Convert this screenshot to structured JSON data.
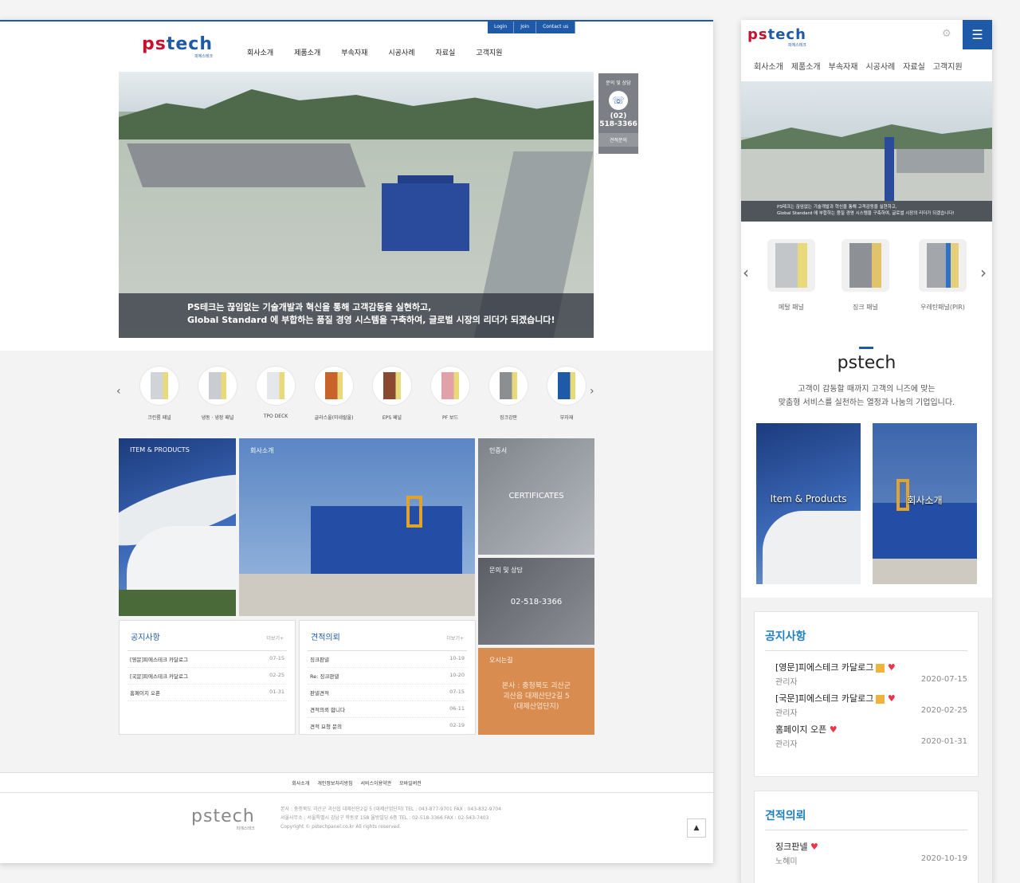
{
  "brand": {
    "part1": "ps",
    "part2": "tech",
    "sub": "피에스테크"
  },
  "desktop": {
    "top_links": [
      "Login",
      "Join",
      "Contact us"
    ],
    "nav": [
      "회사소개",
      "제품소개",
      "부속자재",
      "시공사례",
      "자료실",
      "고객지원"
    ],
    "hero": {
      "line1": "PS테크는 끊임없는 기술개발과 혁신을 통해 고객감동을 실현하고,",
      "line2": "Global Standard 에 부합하는 품질 경영 시스템을 구축하여, 글로벌 시장의 리더가 되겠습니다!"
    },
    "contact_box": {
      "title": "문의 및 상담",
      "tel": "(02)\n518-3366",
      "quote": "견적문의"
    },
    "products": [
      {
        "label": "크린룸 패널",
        "color": "#d0d4d8"
      },
      {
        "label": "냉동 · 냉장 패널",
        "color": "#c9ccd0"
      },
      {
        "label": "TPO DECK",
        "color": "#e4e8ea"
      },
      {
        "label": "글라스울(미네랄울)",
        "color": "#c8642a"
      },
      {
        "label": "EPS 패널",
        "color": "#8a4a32"
      },
      {
        "label": "PF 보드",
        "color": "#e2a0a8"
      },
      {
        "label": "징크강판",
        "color": "#8c8f92"
      },
      {
        "label": "부자재",
        "color": "#1e5aa8"
      }
    ],
    "tiles": {
      "items": "ITEM & PRODUCTS",
      "about": "회사소개",
      "cert_label": "인증서",
      "cert_center": "CERTIFICATES",
      "inq_label": "문의 및 상담",
      "inq_center": "02-518-3366",
      "loc_label": "오시는길",
      "loc_center": "본사 : 충청북도 괴산군\n괴산읍 대제산단2길 5\n(대제산업단지)"
    },
    "notice": {
      "title": "공지사항",
      "more": "더보기+",
      "rows": [
        {
          "t": "[영문]피에스테크 카달로그",
          "d": "07-15"
        },
        {
          "t": "[국문]피에스테크 카달로그",
          "d": "02-25"
        },
        {
          "t": "홈페이지 오픈",
          "d": "01-31"
        }
      ]
    },
    "quote": {
      "title": "견적의뢰",
      "more": "더보기+",
      "rows": [
        {
          "t": "징크판넬",
          "d": "10-19"
        },
        {
          "t": "Re: 징크판넬",
          "d": "10-20"
        },
        {
          "t": "판넬견적",
          "d": "07-15"
        },
        {
          "t": "견적의뢰 합니다",
          "d": "06-11"
        },
        {
          "t": "견적 요청 문의",
          "d": "02-19"
        }
      ]
    },
    "footer_nav": [
      "회사소개",
      "개인정보처리방침",
      "서비스이용약관",
      "모바일버전"
    ],
    "footer_info": [
      "본사 : 충청북도 괴산군 괴산읍 대제산단2길 5 (대제산업단지)   TEL : 043-877-9701 FAX : 043-832-9704",
      "서울사무소 : 서울특별시 강남구 학동로 158 율방빌딩 6층 TEL : 02-518-3366 FAX : 02-543-7403",
      "Copyright © pstechpanel.co.kr All rights reserved."
    ]
  },
  "mobile": {
    "nav": [
      "회사소개",
      "제품소개",
      "부속자재",
      "시공사례",
      "자료실",
      "고객지원"
    ],
    "hero_cap": {
      "line1": "PS테크는 끊임없는 기술개발과 혁신을 통해 고객감동을 실현하고,",
      "line2": "Global Standard 에 부합하는 품질 경영 시스템을 구축하여, 글로벌 시장의 리더가 되겠습니다!"
    },
    "products": [
      "메탈 패널",
      "징크 패널",
      "우레탄패널(PIR)"
    ],
    "intro_title": "pstech",
    "intro_line1": "고객이 감동할 때까지 고객의 니즈에 맞는",
    "intro_line2": "맞춤형 서비스를 실천하는 열정과 나눔의 기업입니다.",
    "card1": "Item & Products",
    "card2": "회사소개",
    "notice": {
      "title": "공지사항",
      "items": [
        {
          "t": "[영문]피에스테크 카달로그",
          "a": "관리자",
          "d": "2020-07-15"
        },
        {
          "t": "[국문]피에스테크 카달로그",
          "a": "관리자",
          "d": "2020-02-25"
        },
        {
          "t": "홈페이지 오픈",
          "a": "관리자",
          "d": "2020-01-31"
        }
      ]
    },
    "quote": {
      "title": "견적의뢰",
      "items": [
        {
          "t": "징크판넬",
          "a": "노혜미",
          "d": "2020-10-19"
        }
      ]
    }
  },
  "colors": {
    "brand_blue": "#1e5aa8",
    "brand_red": "#c8102e",
    "tile_orange": "#d98c4f",
    "heart": "#e8364b"
  }
}
